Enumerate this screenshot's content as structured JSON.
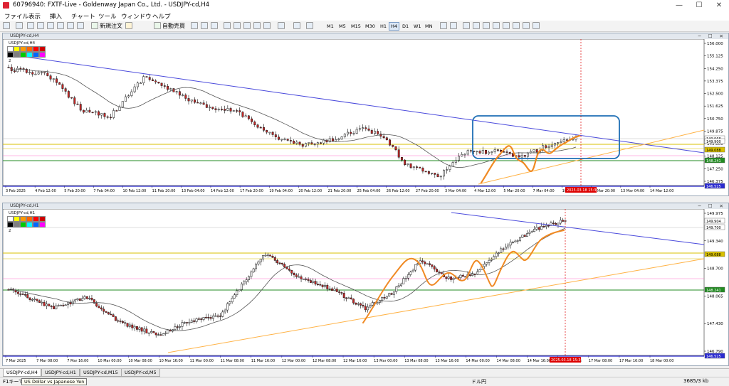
{
  "app": {
    "title": "60796940: FXTF-Live - Goldenway Japan Co., Ltd. - USDJPY-cd,H4",
    "win_min": "—",
    "win_max": "☐",
    "win_close": "✕"
  },
  "menu": [
    "ファイル",
    "表示",
    "挿入",
    "チャート",
    "ツール",
    "ウィンドウ",
    "ヘルプ"
  ],
  "toolbar": {
    "new_order": "新規注文",
    "auto_trade": "自動売買",
    "timeframes": [
      "M1",
      "M5",
      "M15",
      "M30",
      "H1",
      "H4",
      "D1",
      "W1",
      "MN"
    ],
    "active_tf": "H4"
  },
  "chart_top": {
    "window_title": "USDJPY-cd,H4",
    "label": "USDJPY-cd,H4",
    "panel_number": "2",
    "y_ticks": [
      "156.000",
      "155.125",
      "154.250",
      "153.375",
      "152.500",
      "151.625",
      "150.750",
      "149.875",
      "149.000",
      "148.125",
      "147.250",
      "146.375"
    ],
    "x_ticks": [
      "3 Feb 2025",
      "4 Feb 12:00",
      "5 Feb 20:00",
      "7 Feb 04:00",
      "10 Feb 12:00",
      "11 Feb 20:00",
      "13 Feb 04:00",
      "14 Feb 12:00",
      "17 Feb 20:00",
      "19 Feb 04:00",
      "20 Feb 12:00",
      "21 Feb 20:00",
      "25 Feb 04:00",
      "26 Feb 12:00",
      "27 Feb 20:00",
      "3 Mar 04:00",
      "4 Mar 12:00",
      "5 Mar 20:00",
      "7 Mar 04:00",
      "10 Mar 12:00",
      "11 Mar 20:00",
      "13 Mar 04:00",
      "14 Mar 12:00"
    ],
    "time_marker": "2025.03.18 15:30",
    "price_tags": [
      {
        "text": "149.968",
        "bg": "#ffffff",
        "fg": "#000000"
      },
      {
        "text": "149.900",
        "bg": "#ffffff",
        "fg": "#000000"
      },
      {
        "text": "149.088",
        "bg": "#d8c000",
        "fg": "#000000"
      },
      {
        "text": "148.241",
        "bg": "#228b22",
        "fg": "#ffffff"
      },
      {
        "text": "146.525",
        "bg": "#2b2bd0",
        "fg": "#ffffff"
      }
    ]
  },
  "chart_bottom": {
    "window_title": "USDJPY-cd,H1",
    "label": "USDJPY-cd,H1",
    "panel_number": "2",
    "y_ticks": [
      "149.975",
      "149.340",
      "148.700",
      "148.065",
      "147.430",
      "146.790"
    ],
    "x_ticks": [
      "7 Mar 2025",
      "7 Mar 08:00",
      "7 Mar 16:00",
      "10 Mar 00:00",
      "10 Mar 08:00",
      "10 Mar 16:00",
      "11 Mar 00:00",
      "11 Mar 08:00",
      "11 Mar 16:00",
      "12 Mar 00:00",
      "12 Mar 08:00",
      "12 Mar 16:00",
      "13 Mar 00:00",
      "13 Mar 08:00",
      "13 Mar 16:00",
      "14 Mar 00:00",
      "14 Mar 08:00",
      "14 Mar 16:00",
      "17 Mar 00:00",
      "17 Mar 08:00",
      "17 Mar 16:00",
      "18 Mar 00:00"
    ],
    "time_marker": "2025.03.18 15:30",
    "price_tags": [
      {
        "text": "149.904",
        "bg": "#ffffff",
        "fg": "#000000"
      },
      {
        "text": "149.700",
        "bg": "#ffffff",
        "fg": "#000000"
      },
      {
        "text": "149.088",
        "bg": "#d8c000",
        "fg": "#000000"
      },
      {
        "text": "148.241",
        "bg": "#228b22",
        "fg": "#ffffff"
      },
      {
        "text": "146.525",
        "bg": "#2b2bd0",
        "fg": "#ffffff"
      }
    ]
  },
  "tabs": [
    "USDJPY-cd,H4",
    "USDJPY-cd,H1",
    "USDJPY-cd,M15",
    "USDJPY-cd,M5"
  ],
  "active_tab": "USDJPY-cd,H4",
  "status": {
    "help": "F1キーでヘルプ",
    "tooltip": "US Dollar vs Japanese Yen",
    "profile": "ドル円",
    "traffic": "3685/3 kb"
  },
  "palette_colors": [
    "#ffffff",
    "#ffff00",
    "#ff9900",
    "#ff6600",
    "#ff0000",
    "#cc0000",
    "#000000",
    "#808080",
    "#00cc00",
    "#00ffff",
    "#0066ff",
    "#ff00ff"
  ],
  "colors": {
    "bull": "#ffffff",
    "bear": "#c62828",
    "wick": "#111111",
    "ma": "#555555",
    "trend_blue": "#4a4adc",
    "trend_orange": "#ffb347",
    "pattern_orange": "#f08a24",
    "box_blue": "#1f6fb5",
    "line_yellow": "#d8c000",
    "line_green": "#228b22",
    "line_pink": "#ff77cc",
    "line_navy": "#2b2bd0"
  }
}
